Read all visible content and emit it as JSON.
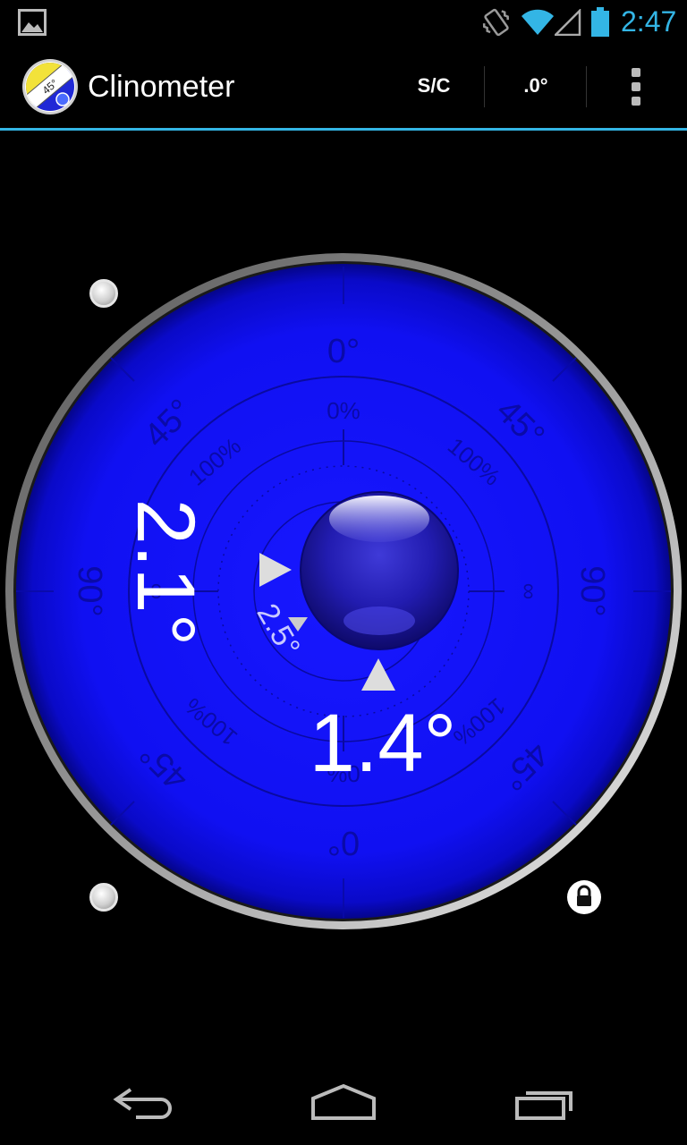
{
  "status_bar": {
    "time": "2:47",
    "icons": [
      "gallery-icon",
      "vibrate-icon",
      "wifi-icon",
      "signal-icon",
      "battery-icon"
    ],
    "accent_color": "#33b5e5"
  },
  "action_bar": {
    "title": "Clinometer",
    "app_icon_label": "45°",
    "buttons": {
      "sc": "S/C",
      "decimal": ".0°"
    }
  },
  "dial": {
    "face_color": "#1010ff",
    "outer_labels": {
      "top": "0°",
      "bottom": "0°",
      "left": "90°",
      "right": "90°",
      "upper_left": "45°",
      "upper_right": "45°",
      "lower_left": "45°",
      "lower_right": "45°"
    },
    "inner_labels": {
      "top": "0%",
      "bottom": "0%",
      "upper_left": "100%",
      "upper_right": "100%",
      "lower_left": "100%",
      "lower_right": "100%",
      "left": "∞",
      "right": "∞"
    },
    "readings": {
      "vertical": "2.1°",
      "horizontal": "1.4°",
      "small": "2.5°"
    }
  },
  "icons": [
    "lock-icon",
    "back-icon",
    "home-icon",
    "recents-icon",
    "overflow-menu-icon"
  ]
}
